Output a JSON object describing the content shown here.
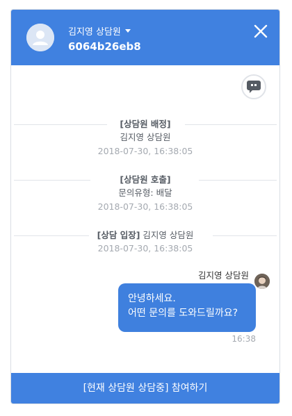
{
  "header": {
    "agent_name": "김지영 상담원",
    "session_id": "6064b26eb8",
    "close_icon": "close-icon",
    "avatar_icon": "user-avatar-icon"
  },
  "chat_icon": "chat-bubble-icon",
  "system_messages": [
    {
      "title": "[상담원 배정]",
      "text": "김지영 상담원",
      "time": "2018-07-30, 16:38:05"
    },
    {
      "title": "[상담원 호출]",
      "text": "문의유형: 배달",
      "time": "2018-07-30, 16:38:05"
    },
    {
      "title": "[상담 입장]",
      "title_suffix": " 김지영 상담원",
      "time": "2018-07-30, 16:38:05"
    }
  ],
  "message": {
    "sender": "김지영 상담원",
    "lines": [
      "안녕하세요.",
      "어떤 문의를 도와드릴까요?"
    ],
    "time": "16:38"
  },
  "footer": {
    "label": "[현재 상담원 상담중] 참여하기"
  },
  "colors": {
    "brand": "#4081e0",
    "bubble": "#3f80de"
  }
}
